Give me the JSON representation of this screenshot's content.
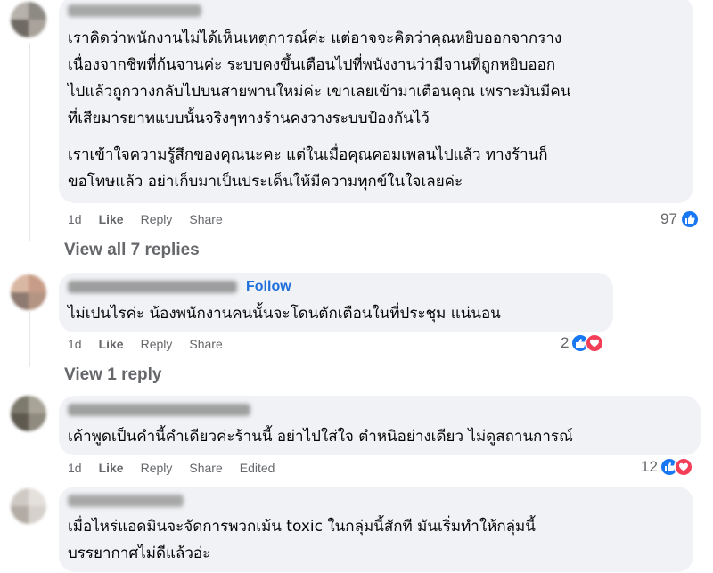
{
  "comments": [
    {
      "paragraphs": [
        [
          "เราคิดว่าพนักงานไม่ได้เห็นเหตุการณ์ค่ะ แต่อาจจะคิดว่าคุณหยิบออกจากราง",
          "เนื่องจากชิพที่ก้นจานค่ะ ระบบคงขึ้นเตือนไปที่พนังงานว่ามีจานที่ถูกหยิบออก",
          "ไปแล้วถูกวางกลับไปบนสายพานใหม่ค่ะ เขาเลยเข้ามาเตือนคุณ เพราะมันมีคน",
          "ที่เสียมารยาทแบบนั้นจริงๆทางร้านคงวางระบบป้องกันไว้"
        ],
        [
          "เราเข้าใจความรู้สึกของคุณนะคะ แต่ในเมื่อคุณคอมเพลนไปแล้ว ทางร้านก็",
          "ขอโทษแล้ว อย่าเก็บมาเป็นประเด็นให้มีความทุกข์ในใจเลยค่ะ"
        ]
      ],
      "time": "1d",
      "like": "Like",
      "reply": "Reply",
      "share": "Share",
      "reaction_count": "97",
      "view_replies": "View all 7 replies"
    },
    {
      "follow": "Follow",
      "text": "ไม่เปนไรค่ะ น้องพนักงานคนนั้นจะโดนตักเตือนในที่ประชุม แน่นอน",
      "time": "1d",
      "like": "Like",
      "reply": "Reply",
      "share": "Share",
      "reaction_count": "2",
      "view_replies": "View 1 reply"
    },
    {
      "text": "เค้าพูดเป็นคำนี้คำเดียวค่ะร้านนี้ อย่าไปใส่ใจ ตำหนิอย่างเดียว ไม่ดูสถานการณ์",
      "time": "1d",
      "like": "Like",
      "reply": "Reply",
      "share": "Share",
      "edited": "Edited",
      "reaction_count": "12"
    },
    {
      "lines": [
        "เมื่อไหร่แอดมินจะจัดการพวกเม้น toxic ในกลุ่มนี้สักที มันเริ่มทำให้กลุ่มนี้",
        "บรรยากาศไม่ดีแล้วอ่ะ"
      ]
    }
  ],
  "colors": {
    "bubble": "#f0f2f5",
    "link_blue": "#216fdb",
    "like_blue": "#1877f2",
    "love_red": "#f33e58",
    "meta_gray": "#65676b"
  },
  "icons": [
    "like-reaction-icon",
    "love-reaction-icon"
  ]
}
